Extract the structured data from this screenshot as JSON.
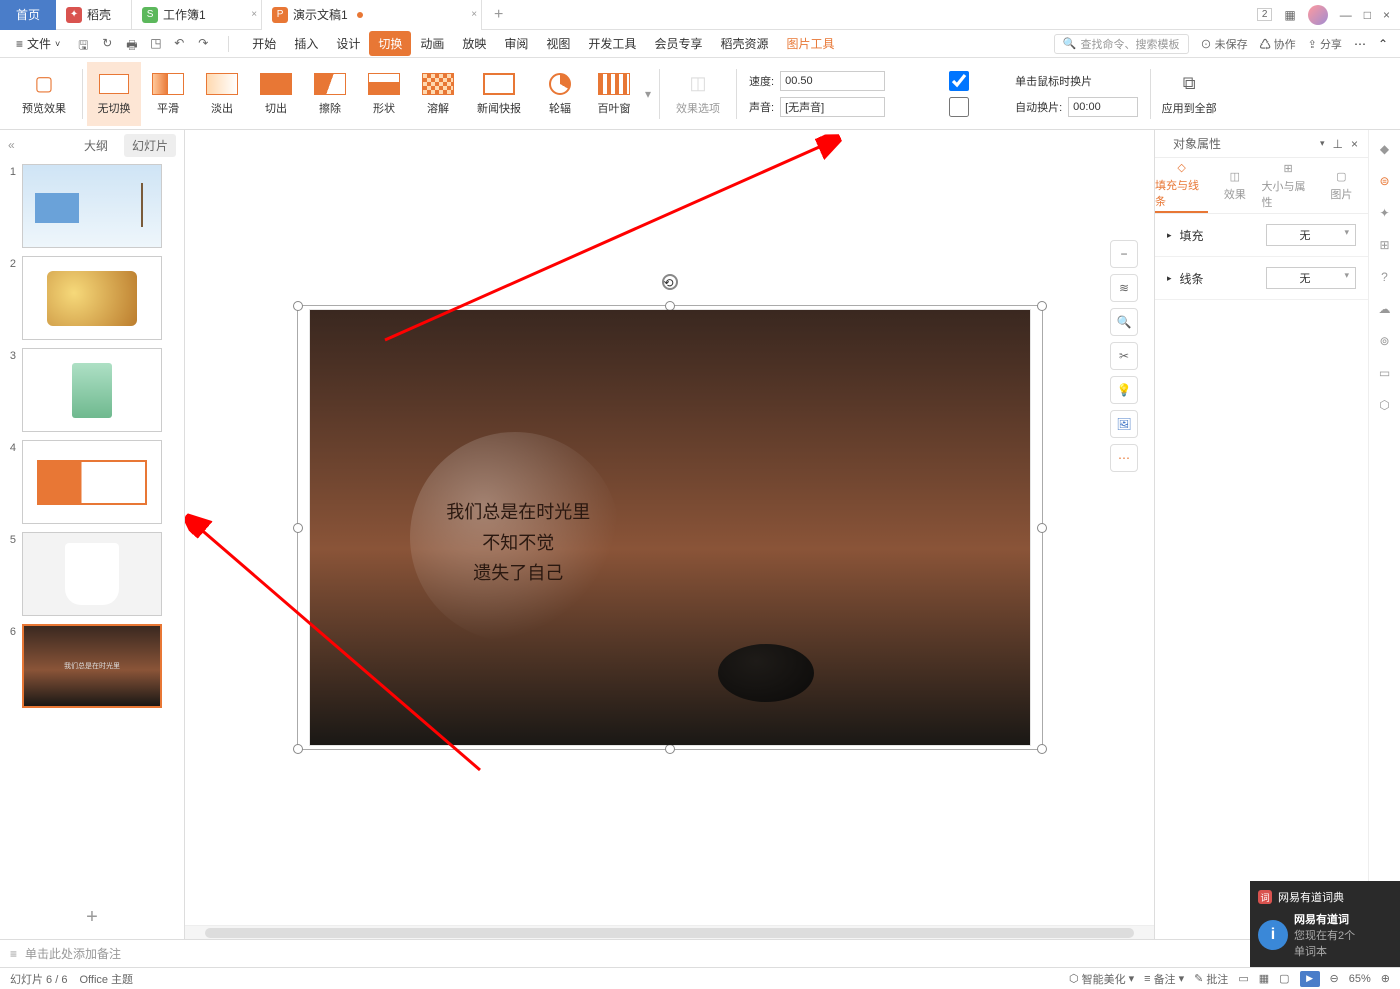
{
  "titlebar": {
    "home": "首页",
    "tabs": [
      {
        "icon": "red",
        "glyph": "✦",
        "label": "稻壳"
      },
      {
        "icon": "green",
        "glyph": "S",
        "label": "工作簿1"
      },
      {
        "icon": "orange",
        "glyph": "P",
        "label": "演示文稿1",
        "modified": true,
        "active": true
      }
    ],
    "badge": "2"
  },
  "menubar": {
    "file": "文件",
    "tabs": [
      "开始",
      "插入",
      "设计",
      "切换",
      "动画",
      "放映",
      "审阅",
      "视图",
      "开发工具",
      "会员专享",
      "稻壳资源"
    ],
    "active_tab": "切换",
    "context_tab": "图片工具",
    "search_placeholder": "查找命令、搜索模板",
    "unsaved": "未保存",
    "coop": "协作",
    "share": "分享"
  },
  "ribbon": {
    "preview": "预览效果",
    "transitions": [
      "无切换",
      "平滑",
      "淡出",
      "切出",
      "擦除",
      "形状",
      "溶解",
      "新闻快报",
      "轮辐",
      "百叶窗"
    ],
    "effect_options": "效果选项",
    "speed_label": "速度:",
    "speed_value": "00.50",
    "sound_label": "声音:",
    "sound_value": "[无声音]",
    "click_advance": "单击鼠标时换片",
    "auto_advance": "自动换片:",
    "auto_value": "00:00",
    "apply_all": "应用到全部"
  },
  "slide_panel": {
    "tabs": [
      "大纲",
      "幻灯片"
    ],
    "active": "幻灯片",
    "count": 6,
    "selected": 6
  },
  "slide_content": {
    "line1": "我们总是在时光里",
    "line2": "不知不觉",
    "line3": "遗失了自己"
  },
  "right_panel": {
    "title": "对象属性",
    "tabs": [
      "填充与线条",
      "效果",
      "大小与属性",
      "图片"
    ],
    "active": "填充与线条",
    "fill_label": "填充",
    "fill_value": "无",
    "line_label": "线条",
    "line_value": "无"
  },
  "notes": {
    "placeholder": "单击此处添加备注"
  },
  "statusbar": {
    "slide_info": "幻灯片 6 / 6",
    "theme": "Office 主题",
    "beautify": "智能美化",
    "notes_btn": "备注",
    "comments_btn": "批注",
    "zoom": "65%"
  },
  "popup": {
    "title": "网易有道词典",
    "heading": "网易有道词",
    "sub": "您现在有2个",
    "action": "单词本"
  }
}
